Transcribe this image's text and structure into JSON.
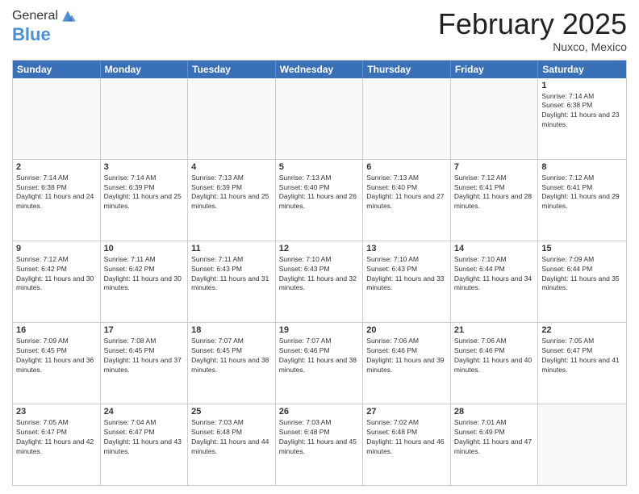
{
  "logo": {
    "general": "General",
    "blue": "Blue"
  },
  "header": {
    "month_year": "February 2025",
    "location": "Nuxco, Mexico"
  },
  "weekdays": [
    "Sunday",
    "Monday",
    "Tuesday",
    "Wednesday",
    "Thursday",
    "Friday",
    "Saturday"
  ],
  "rows": [
    [
      {
        "day": "",
        "text": ""
      },
      {
        "day": "",
        "text": ""
      },
      {
        "day": "",
        "text": ""
      },
      {
        "day": "",
        "text": ""
      },
      {
        "day": "",
        "text": ""
      },
      {
        "day": "",
        "text": ""
      },
      {
        "day": "1",
        "text": "Sunrise: 7:14 AM\nSunset: 6:38 PM\nDaylight: 11 hours and 23 minutes."
      }
    ],
    [
      {
        "day": "2",
        "text": "Sunrise: 7:14 AM\nSunset: 6:38 PM\nDaylight: 11 hours and 24 minutes."
      },
      {
        "day": "3",
        "text": "Sunrise: 7:14 AM\nSunset: 6:39 PM\nDaylight: 11 hours and 25 minutes."
      },
      {
        "day": "4",
        "text": "Sunrise: 7:13 AM\nSunset: 6:39 PM\nDaylight: 11 hours and 25 minutes."
      },
      {
        "day": "5",
        "text": "Sunrise: 7:13 AM\nSunset: 6:40 PM\nDaylight: 11 hours and 26 minutes."
      },
      {
        "day": "6",
        "text": "Sunrise: 7:13 AM\nSunset: 6:40 PM\nDaylight: 11 hours and 27 minutes."
      },
      {
        "day": "7",
        "text": "Sunrise: 7:12 AM\nSunset: 6:41 PM\nDaylight: 11 hours and 28 minutes."
      },
      {
        "day": "8",
        "text": "Sunrise: 7:12 AM\nSunset: 6:41 PM\nDaylight: 11 hours and 29 minutes."
      }
    ],
    [
      {
        "day": "9",
        "text": "Sunrise: 7:12 AM\nSunset: 6:42 PM\nDaylight: 11 hours and 30 minutes."
      },
      {
        "day": "10",
        "text": "Sunrise: 7:11 AM\nSunset: 6:42 PM\nDaylight: 11 hours and 30 minutes."
      },
      {
        "day": "11",
        "text": "Sunrise: 7:11 AM\nSunset: 6:43 PM\nDaylight: 11 hours and 31 minutes."
      },
      {
        "day": "12",
        "text": "Sunrise: 7:10 AM\nSunset: 6:43 PM\nDaylight: 11 hours and 32 minutes."
      },
      {
        "day": "13",
        "text": "Sunrise: 7:10 AM\nSunset: 6:43 PM\nDaylight: 11 hours and 33 minutes."
      },
      {
        "day": "14",
        "text": "Sunrise: 7:10 AM\nSunset: 6:44 PM\nDaylight: 11 hours and 34 minutes."
      },
      {
        "day": "15",
        "text": "Sunrise: 7:09 AM\nSunset: 6:44 PM\nDaylight: 11 hours and 35 minutes."
      }
    ],
    [
      {
        "day": "16",
        "text": "Sunrise: 7:09 AM\nSunset: 6:45 PM\nDaylight: 11 hours and 36 minutes."
      },
      {
        "day": "17",
        "text": "Sunrise: 7:08 AM\nSunset: 6:45 PM\nDaylight: 11 hours and 37 minutes."
      },
      {
        "day": "18",
        "text": "Sunrise: 7:07 AM\nSunset: 6:45 PM\nDaylight: 11 hours and 38 minutes."
      },
      {
        "day": "19",
        "text": "Sunrise: 7:07 AM\nSunset: 6:46 PM\nDaylight: 11 hours and 38 minutes."
      },
      {
        "day": "20",
        "text": "Sunrise: 7:06 AM\nSunset: 6:46 PM\nDaylight: 11 hours and 39 minutes."
      },
      {
        "day": "21",
        "text": "Sunrise: 7:06 AM\nSunset: 6:46 PM\nDaylight: 11 hours and 40 minutes."
      },
      {
        "day": "22",
        "text": "Sunrise: 7:05 AM\nSunset: 6:47 PM\nDaylight: 11 hours and 41 minutes."
      }
    ],
    [
      {
        "day": "23",
        "text": "Sunrise: 7:05 AM\nSunset: 6:47 PM\nDaylight: 11 hours and 42 minutes."
      },
      {
        "day": "24",
        "text": "Sunrise: 7:04 AM\nSunset: 6:47 PM\nDaylight: 11 hours and 43 minutes."
      },
      {
        "day": "25",
        "text": "Sunrise: 7:03 AM\nSunset: 6:48 PM\nDaylight: 11 hours and 44 minutes."
      },
      {
        "day": "26",
        "text": "Sunrise: 7:03 AM\nSunset: 6:48 PM\nDaylight: 11 hours and 45 minutes."
      },
      {
        "day": "27",
        "text": "Sunrise: 7:02 AM\nSunset: 6:48 PM\nDaylight: 11 hours and 46 minutes."
      },
      {
        "day": "28",
        "text": "Sunrise: 7:01 AM\nSunset: 6:49 PM\nDaylight: 11 hours and 47 minutes."
      },
      {
        "day": "",
        "text": ""
      }
    ]
  ]
}
